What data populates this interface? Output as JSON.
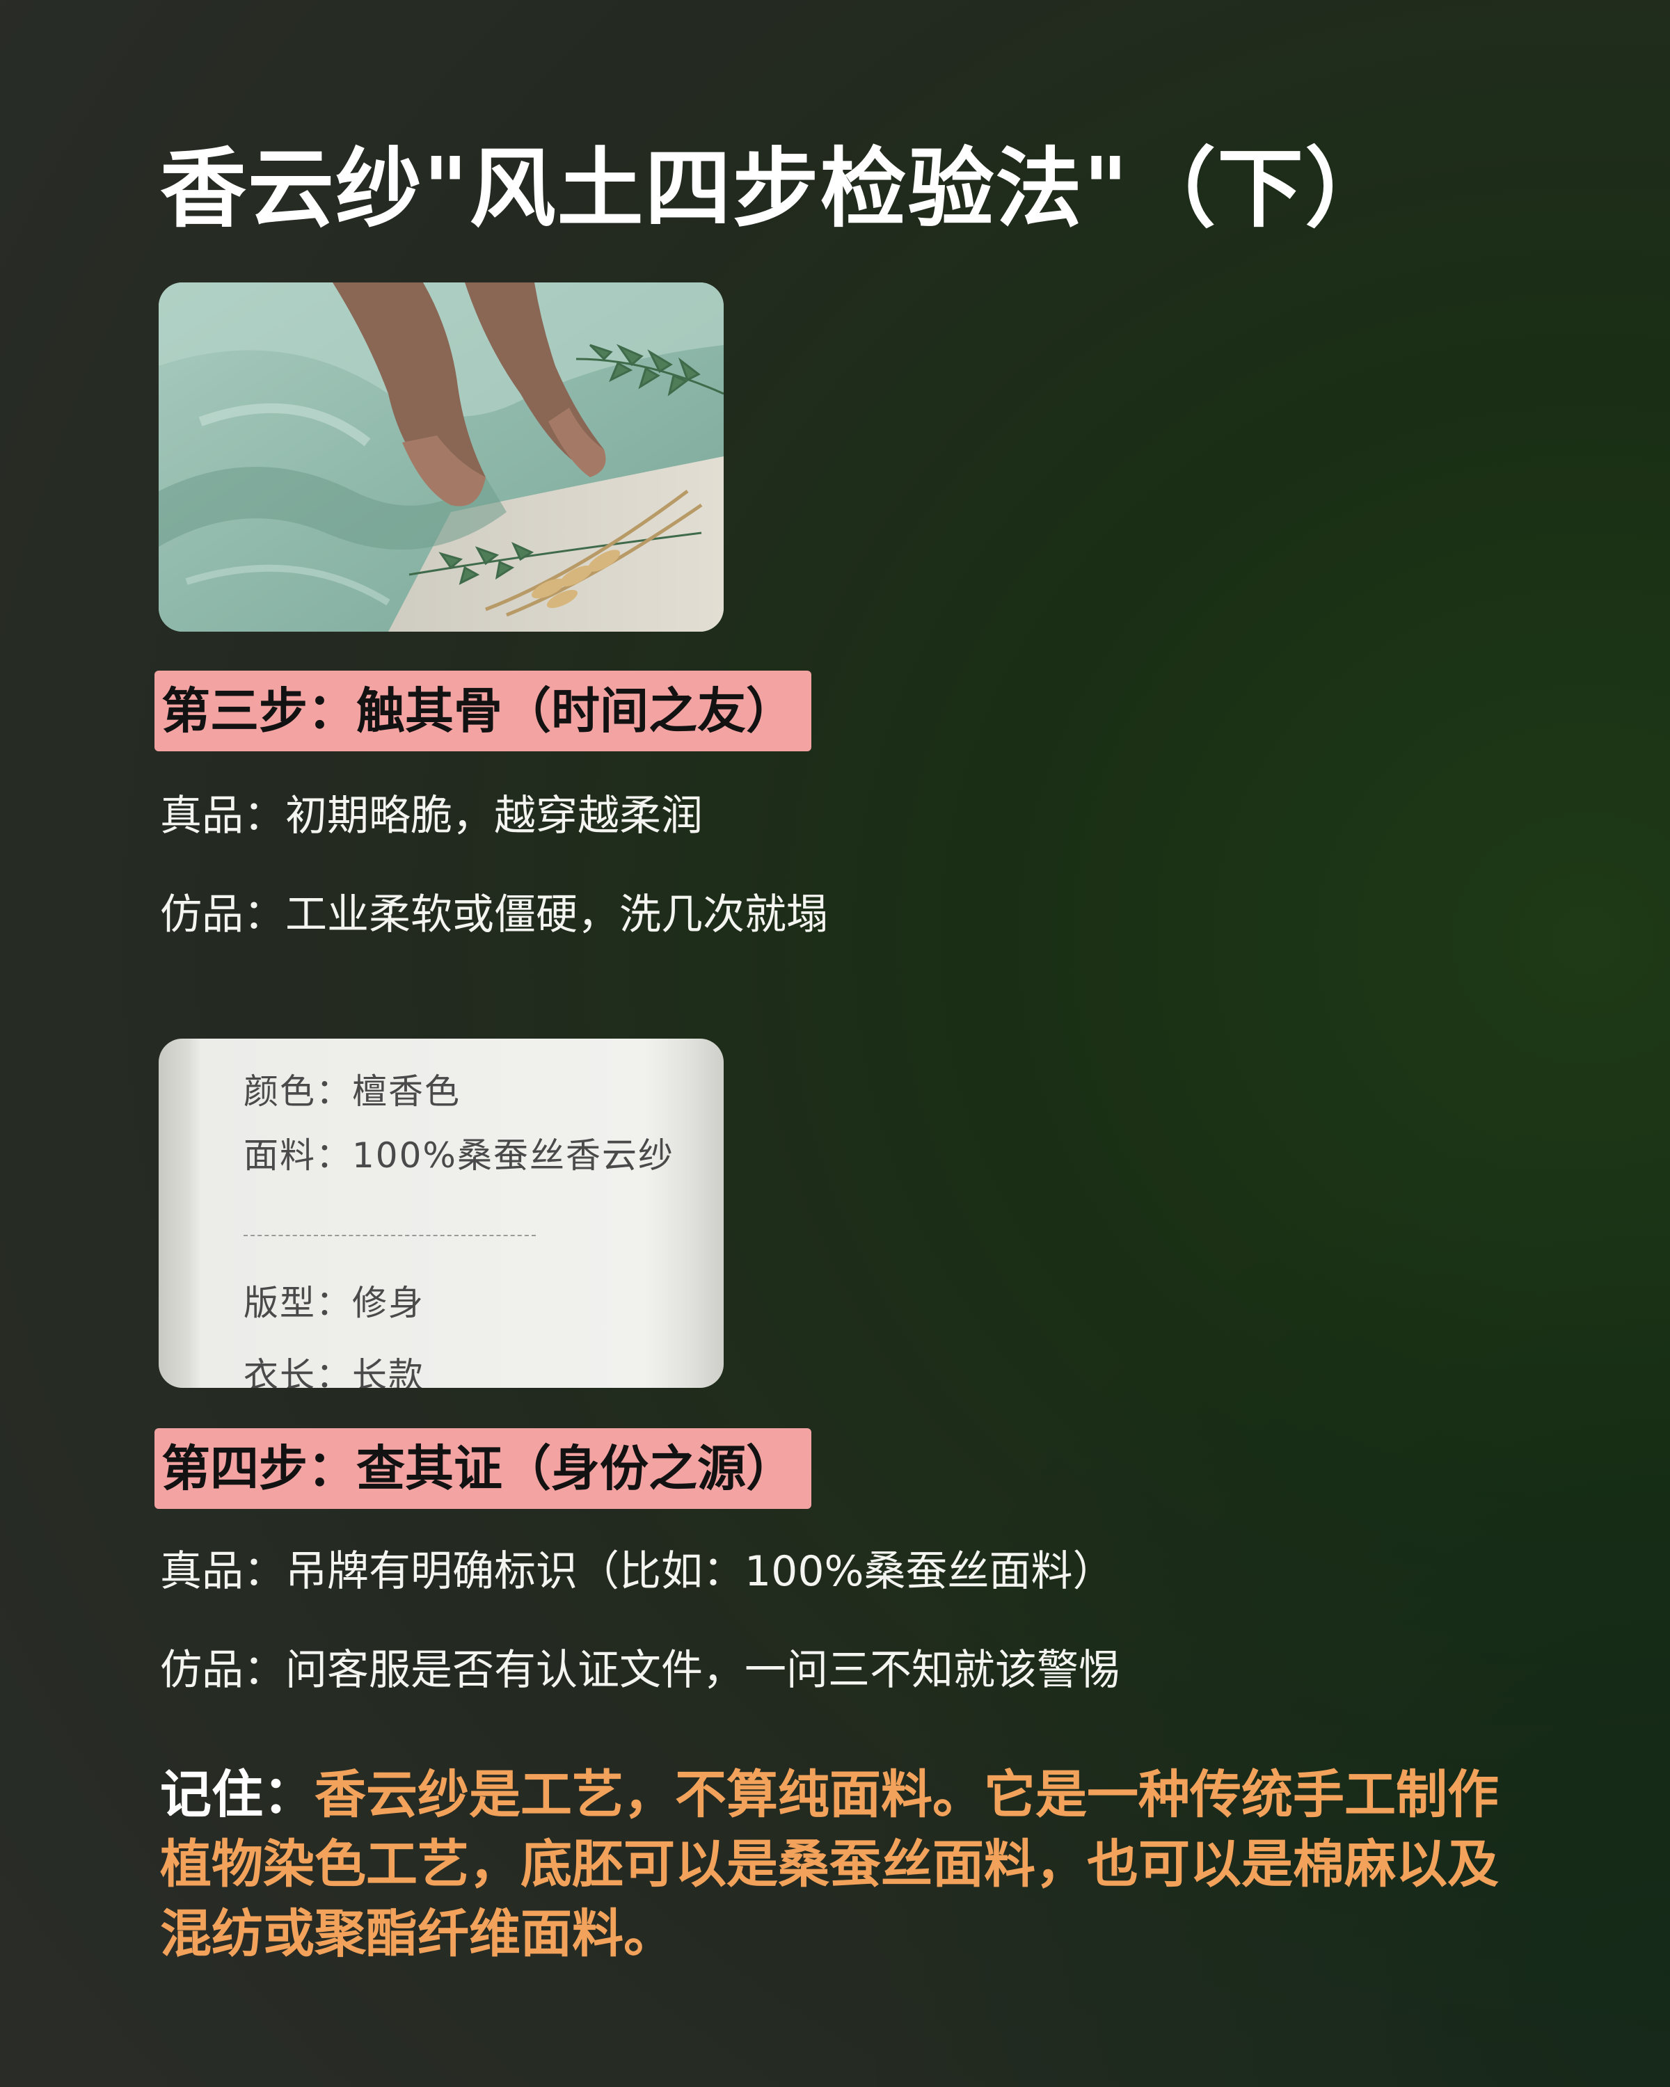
{
  "title": "香云纱\"风土四步检验法\"（下）",
  "colors": {
    "step_highlight": "#f4a3a3",
    "accent_text": "#f2a25a",
    "background": "#1f2a1c"
  },
  "step3": {
    "heading": "第三步：触其骨（时间之友）",
    "genuine": "真品：初期略脆，越穿越柔润",
    "fake": "仿品：工业柔软或僵硬，洗几次就塌"
  },
  "label_card": {
    "color_row": "颜色：檀香色",
    "fabric_row": "面料：100%桑蚕丝香云纱",
    "fit_row": "版型：修身",
    "length_row": "衣长：长款"
  },
  "step4": {
    "heading": "第四步：查其证（身份之源）",
    "genuine": "真品：吊牌有明确标识（比如：100%桑蚕丝面料）",
    "fake": "仿品：问客服是否有认证文件，一问三不知就该警惕"
  },
  "remember": {
    "lead": "记住：",
    "text": "香云纱是工艺，不算纯面料。它是一种传统手工制作植物染色工艺，底胚可以是桑蚕丝面料，也可以是棉麻以及混纺或聚酯纤维面料。"
  }
}
